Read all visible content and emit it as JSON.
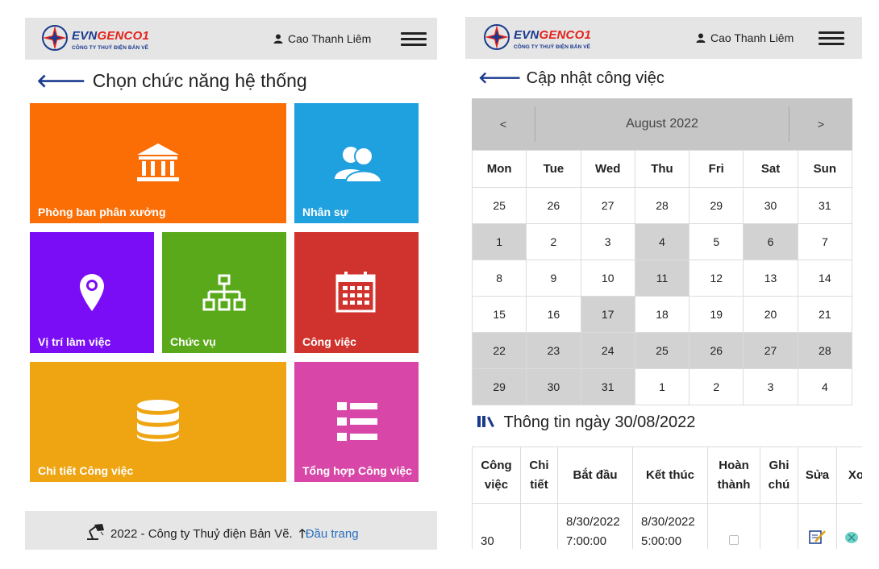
{
  "left": {
    "logo": {
      "brand_a": "EVN",
      "brand_b": "GENCO1",
      "tagline": "CÔNG TY THUỶ ĐIỆN BẢN VẼ"
    },
    "user": {
      "name": "Cao Thanh Liêm",
      "icon": "user-icon"
    },
    "menu_icon": "hamburger-icon",
    "title": "Chọn chức năng hệ thống",
    "back_icon": "arrow-left-icon",
    "tiles": [
      {
        "label": "Phòng ban phân xưởng",
        "icon": "bank-icon",
        "color": "#fb6d05"
      },
      {
        "label": "Nhân sự",
        "icon": "users-icon",
        "color": "#1fa0df"
      },
      {
        "label": "Vị trí làm việc",
        "icon": "map-pin-icon",
        "color": "#7a0df5"
      },
      {
        "label": "Chức vụ",
        "icon": "sitemap-icon",
        "color": "#5aa91b"
      },
      {
        "label": "Công việc",
        "icon": "calendar-icon",
        "color": "#d0332d"
      },
      {
        "label": "Chi tiết Công việc",
        "icon": "database-icon",
        "color": "#efa412"
      },
      {
        "label": "Tổng hợp Công việc",
        "icon": "list-icon",
        "color": "#d847a8"
      }
    ],
    "footer": {
      "text": "2022 - Công ty Thuỷ điện Bản Vẽ.",
      "link": "Đầu trang",
      "icon": "lamp-icon",
      "link_icon": "arrow-up-icon"
    }
  },
  "right": {
    "logo": {
      "brand_a": "EVN",
      "brand_b": "GENCO1",
      "tagline": "CÔNG TY THUỶ ĐIỆN BẢN VẼ"
    },
    "user": {
      "name": "Cao Thanh Liêm"
    },
    "title": "Cập nhật công việc",
    "calendar": {
      "prev": "<",
      "next": ">",
      "month": "August 2022",
      "weekdays": [
        "Mon",
        "Tue",
        "Wed",
        "Thu",
        "Fri",
        "Sat",
        "Sun"
      ],
      "weeks": [
        [
          [
            "25",
            "other"
          ],
          [
            "26",
            "other"
          ],
          [
            "27",
            "other"
          ],
          [
            "28",
            "other"
          ],
          [
            "29",
            "other"
          ],
          [
            "30",
            "other"
          ],
          [
            "31",
            "other"
          ]
        ],
        [
          [
            "1",
            "hl"
          ],
          [
            "2",
            ""
          ],
          [
            "3",
            ""
          ],
          [
            "4",
            "hl"
          ],
          [
            "5",
            ""
          ],
          [
            "6",
            "hl"
          ],
          [
            "7",
            "red"
          ]
        ],
        [
          [
            "8",
            ""
          ],
          [
            "9",
            ""
          ],
          [
            "10",
            ""
          ],
          [
            "11",
            "hl"
          ],
          [
            "12",
            ""
          ],
          [
            "13",
            "red"
          ],
          [
            "14",
            "red"
          ]
        ],
        [
          [
            "15",
            ""
          ],
          [
            "16",
            ""
          ],
          [
            "17",
            "hl"
          ],
          [
            "18",
            ""
          ],
          [
            "19",
            ""
          ],
          [
            "20",
            "red"
          ],
          [
            "21",
            "red"
          ]
        ],
        [
          [
            "22",
            "hl"
          ],
          [
            "23",
            "hl"
          ],
          [
            "24",
            "hl"
          ],
          [
            "25",
            "hl"
          ],
          [
            "26",
            "hl"
          ],
          [
            "27",
            "hl"
          ],
          [
            "28",
            "hl"
          ]
        ],
        [
          [
            "29",
            "hl"
          ],
          [
            "30",
            "hl"
          ],
          [
            "31",
            "hl"
          ],
          [
            "1",
            "other"
          ],
          [
            "2",
            "other"
          ],
          [
            "3",
            "other"
          ],
          [
            "4",
            "other"
          ]
        ]
      ]
    },
    "info_title": "Thông tin ngày 30/08/2022",
    "info_icon": "books-icon",
    "table": {
      "headers": [
        [
          "Công",
          "việc"
        ],
        [
          "Chi",
          "tiết"
        ],
        [
          "Bắt đầu"
        ],
        [
          "Kết thúc"
        ],
        [
          "Hoàn",
          "thành"
        ],
        [
          "Ghi",
          "chú"
        ],
        [
          "Sửa"
        ],
        [
          "Xo"
        ]
      ],
      "row": {
        "job": "30",
        "detail": "",
        "start_date": "8/30/2022",
        "start_time": "7:00:00",
        "end_date": "8/30/2022",
        "end_time": "5:00:00",
        "done": false,
        "note": "",
        "edit_icon": "edit-icon",
        "delete_icon": "delete-icon"
      }
    }
  }
}
